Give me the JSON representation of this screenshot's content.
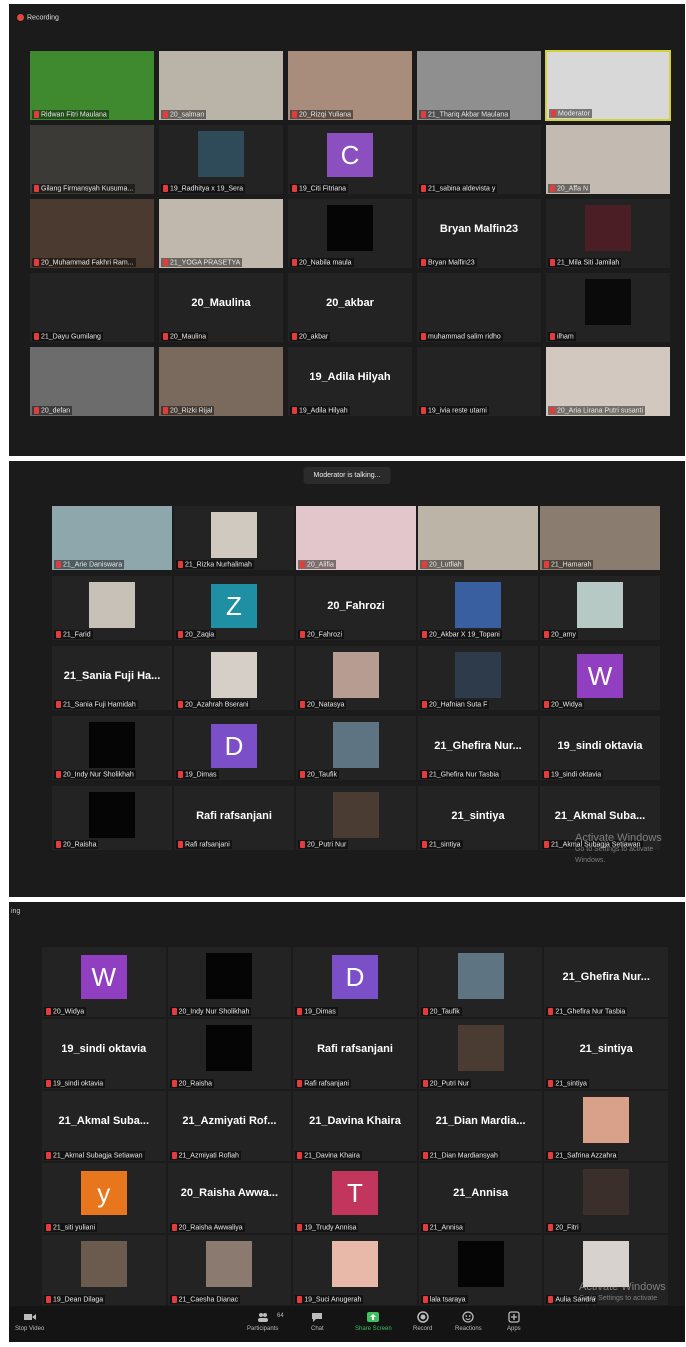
{
  "panel1": {
    "recording_label": "Recording",
    "tiles": [
      {
        "name": "Ridwan Fitri Maulana",
        "kind": "video",
        "bg": "#3f8a2f"
      },
      {
        "name": "20_salman",
        "kind": "video",
        "bg": "#b9b3a8"
      },
      {
        "name": "20_Rizqi Yuliana",
        "kind": "video",
        "bg": "#a88c7c"
      },
      {
        "name": "21_Thariq Akbar Maulana",
        "kind": "video",
        "bg": "#8f8f8f"
      },
      {
        "name": "Moderator",
        "kind": "video",
        "bg": "#d8d8d8",
        "speaking": true
      },
      {
        "name": "Gilang Firmansyah Kusuma...",
        "kind": "video",
        "bg": "#3c3a36"
      },
      {
        "name": "19_Radhitya x 19_Sera",
        "kind": "thumb",
        "bg": "#2f4a58"
      },
      {
        "name": "19_Citi Fitriana",
        "kind": "letter",
        "letter": "C",
        "bg": "#8b4fbf"
      },
      {
        "name": "21_sabina aldevista y",
        "kind": "empty"
      },
      {
        "name": "20_Affa N",
        "kind": "video",
        "bg": "#c3bbb2"
      },
      {
        "name": "20_Muhammad Fakhri Ram...",
        "kind": "video",
        "bg": "#4a3a2f"
      },
      {
        "name": "21_YOGA PRASETYA",
        "kind": "video",
        "bg": "#c0b8ac"
      },
      {
        "name": "20_Nabila maula",
        "kind": "thumb",
        "bg": "#050505"
      },
      {
        "name": "Bryan Malfin23",
        "kind": "text",
        "display": "Bryan Malfin23"
      },
      {
        "name": "21_Mila Siti Jamilah",
        "kind": "thumb",
        "bg": "#4a1e24"
      },
      {
        "name": "21_Dayu Gumilang",
        "kind": "empty"
      },
      {
        "name": "20_Maulina",
        "kind": "text",
        "display": "20_Maulina"
      },
      {
        "name": "20_akbar",
        "kind": "text",
        "display": "20_akbar"
      },
      {
        "name": "muhammad salim ridho",
        "kind": "empty"
      },
      {
        "name": "ilham",
        "kind": "thumb",
        "bg": "#0a0a0a"
      },
      {
        "name": "20_defan",
        "kind": "video",
        "bg": "#6c6c6c"
      },
      {
        "name": "20_Rizki Rijal",
        "kind": "video",
        "bg": "#7a6a5e"
      },
      {
        "name": "19_Adila Hilyah",
        "kind": "text",
        "display": "19_Adila Hilyah"
      },
      {
        "name": "19_ivia reste utami",
        "kind": "empty"
      },
      {
        "name": "20_Aria Lirana Putri susanti",
        "kind": "video",
        "bg": "#d2c8bf"
      }
    ]
  },
  "panel2": {
    "talking_label": "Moderator is talking...",
    "tiles": [
      {
        "name": "21_Arie Daniswara",
        "kind": "video",
        "bg": "#8ea7ad"
      },
      {
        "name": "21_Rizka Nurhalimah",
        "kind": "thumb",
        "bg": "#cfc9c0"
      },
      {
        "name": "20_Alifia",
        "kind": "video",
        "bg": "#e2c6cb"
      },
      {
        "name": "20_Lutfiah",
        "kind": "video",
        "bg": "#bdb4a8"
      },
      {
        "name": "21_Hamarah",
        "kind": "video",
        "bg": "#8a7d70"
      },
      {
        "name": "21_Farid",
        "kind": "thumb",
        "bg": "#c7c1b8"
      },
      {
        "name": "20_Zaqia",
        "kind": "letter",
        "letter": "Z",
        "bg": "#1f8fa3"
      },
      {
        "name": "20_Fahrozi",
        "kind": "text",
        "display": "20_Fahrozi"
      },
      {
        "name": "20_Akbar X 19_Topani",
        "kind": "thumb",
        "bg": "#3a5fa0"
      },
      {
        "name": "20_amy",
        "kind": "thumb",
        "bg": "#b6c9c4"
      },
      {
        "name": "21_Sania Fuji Hamidah",
        "kind": "text",
        "display": "21_Sania Fuji Ha..."
      },
      {
        "name": "20_Azahrah Bserani",
        "kind": "thumb",
        "bg": "#d6cfc8"
      },
      {
        "name": "20_Natasya",
        "kind": "thumb",
        "bg": "#b79c92"
      },
      {
        "name": "20_Hafnian Suta F",
        "kind": "thumb",
        "bg": "#2d3b4a"
      },
      {
        "name": "20_Widya",
        "kind": "letter",
        "letter": "W",
        "bg": "#8f3fbf"
      },
      {
        "name": "20_Indy Nur Sholikhah",
        "kind": "thumb",
        "bg": "#050505"
      },
      {
        "name": "19_Dimas",
        "kind": "letter",
        "letter": "D",
        "bg": "#7a4fc7"
      },
      {
        "name": "20_Taufik",
        "kind": "thumb",
        "bg": "#5f7482"
      },
      {
        "name": "21_Ghefira Nur Tasbia",
        "kind": "text",
        "display": "21_Ghefira Nur..."
      },
      {
        "name": "19_sindi oktavia",
        "kind": "text",
        "display": "19_sindi oktavia"
      },
      {
        "name": "20_Raisha",
        "kind": "thumb",
        "bg": "#050505"
      },
      {
        "name": "Rafi rafsanjani",
        "kind": "text",
        "display": "Rafi rafsanjani"
      },
      {
        "name": "20_Putri Nur",
        "kind": "thumb",
        "bg": "#4a3c33"
      },
      {
        "name": "21_sintiya",
        "kind": "text",
        "display": "21_sintiya"
      },
      {
        "name": "21_Akmal Subagja Setiawan",
        "kind": "text",
        "display": "21_Akmal Suba..."
      }
    ],
    "watermark_title": "Activate Windows",
    "watermark_sub": "Go to Settings to activate Windows."
  },
  "panel3": {
    "cut_label": "ing",
    "tiles": [
      {
        "name": "20_Widya",
        "kind": "letter",
        "letter": "W",
        "bg": "#8f3fbf"
      },
      {
        "name": "20_Indy Nur Sholikhah",
        "kind": "thumb",
        "bg": "#050505"
      },
      {
        "name": "19_Dimas",
        "kind": "letter",
        "letter": "D",
        "bg": "#7a4fc7"
      },
      {
        "name": "20_Taufik",
        "kind": "thumb",
        "bg": "#5f7482"
      },
      {
        "name": "21_Ghefira Nur Tasbia",
        "kind": "text",
        "display": "21_Ghefira Nur..."
      },
      {
        "name": "19_sindi oktavia",
        "kind": "text",
        "display": "19_sindi oktavia"
      },
      {
        "name": "20_Raisha",
        "kind": "thumb",
        "bg": "#050505"
      },
      {
        "name": "Rafi rafsanjani",
        "kind": "text",
        "display": "Rafi rafsanjani"
      },
      {
        "name": "20_Putri Nur",
        "kind": "thumb",
        "bg": "#4a3c33"
      },
      {
        "name": "21_sintiya",
        "kind": "text",
        "display": "21_sintiya"
      },
      {
        "name": "21_Akmal Subagja Setiawan",
        "kind": "text",
        "display": "21_Akmal Suba..."
      },
      {
        "name": "21_Azmiyati Rofiah",
        "kind": "text",
        "display": "21_Azmiyati Rof..."
      },
      {
        "name": "21_Davina Khaira",
        "kind": "text",
        "display": "21_Davina Khaira"
      },
      {
        "name": "21_Dian Mardiansyah",
        "kind": "text",
        "display": "21_Dian Mardia..."
      },
      {
        "name": "21_Safrina Azzahra",
        "kind": "thumb",
        "bg": "#d9a08a"
      },
      {
        "name": "21_siti yuliani",
        "kind": "letter",
        "letter": "y",
        "bg": "#e8761c"
      },
      {
        "name": "20_Raisha Awwaliya",
        "kind": "text",
        "display": "20_Raisha Awwa..."
      },
      {
        "name": "19_Trudy Annisa",
        "kind": "letter",
        "letter": "T",
        "bg": "#c2355d"
      },
      {
        "name": "21_Annisa",
        "kind": "text",
        "display": "21_Annisa"
      },
      {
        "name": "20_Fitri",
        "kind": "thumb",
        "bg": "#3a2f2b"
      },
      {
        "name": "19_Dean Dilaga",
        "kind": "thumb",
        "bg": "#6b5b4f"
      },
      {
        "name": "21_Caesha Dianac",
        "kind": "thumb",
        "bg": "#8a7a70"
      },
      {
        "name": "19_Suci Anugerah",
        "kind": "thumb",
        "bg": "#e8b9a8"
      },
      {
        "name": "lala tsaraya",
        "kind": "thumb",
        "bg": "#050505"
      },
      {
        "name": "Aulia Sandra",
        "kind": "thumb",
        "bg": "#d8d2ce"
      }
    ],
    "watermark_title": "Activate Windows",
    "watermark_sub": "Go to Settings to activate Windows.",
    "toolbar": {
      "stop_video": "Stop Video",
      "participants": "Participants",
      "participants_count": "64",
      "chat": "Chat",
      "share_screen": "Share Screen",
      "record": "Record",
      "reactions": "Reactions",
      "apps": "Apps"
    }
  }
}
